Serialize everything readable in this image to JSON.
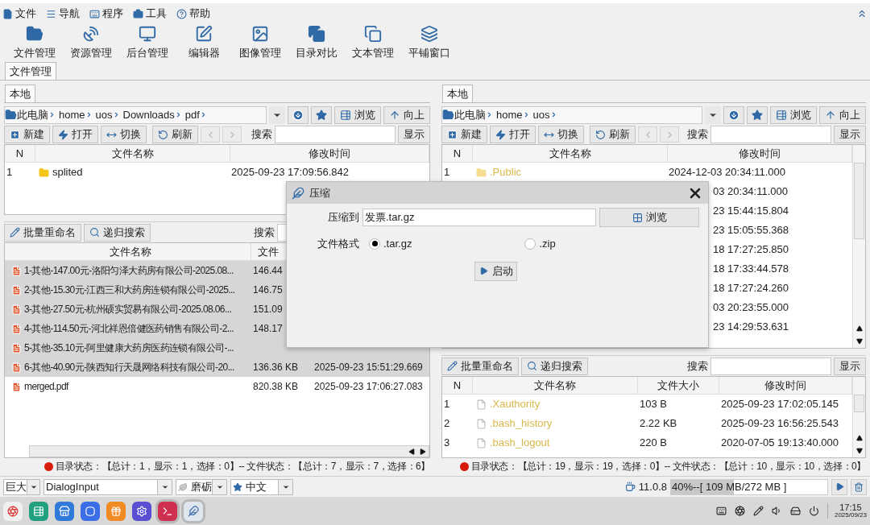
{
  "menu": [
    {
      "label": "文件"
    },
    {
      "label": "导航"
    },
    {
      "label": "程序"
    },
    {
      "label": "工具"
    },
    {
      "label": "帮助"
    }
  ],
  "toolbar": [
    {
      "label": "文件管理"
    },
    {
      "label": "资源管理"
    },
    {
      "label": "后台管理"
    },
    {
      "label": "编辑器"
    },
    {
      "label": "图像管理"
    },
    {
      "label": "目录对比"
    },
    {
      "label": "文本管理"
    },
    {
      "label": "平铺窗口"
    }
  ],
  "main_tabs": [
    {
      "label": "文件管理",
      "selected": true
    }
  ],
  "panes": [
    {
      "tab": {
        "label": "本地",
        "selected": true
      },
      "path": [
        "此电脑",
        "home",
        "uos",
        "Downloads",
        "pdf"
      ],
      "browse": "浏览",
      "up": "向上",
      "actions": [
        "新建",
        "打开",
        "切换",
        "刷新"
      ],
      "nav": [
        {
          "disabled": true
        },
        {
          "disabled": true
        }
      ],
      "search_label": "搜索",
      "show": "显示",
      "top_table": {
        "columns": [
          "N",
          "文件名称",
          "修改时间"
        ],
        "rows": [
          {
            "kind": "full",
            "n": "1",
            "name": "splited",
            "hidden": false,
            "time": "2025-09-23 17:09:56.842"
          }
        ]
      },
      "bottom_tools": [
        "批量重命名",
        "递归搜索"
      ],
      "bottom_search_label": "搜索",
      "bottom_table": {
        "columns": [
          "文件名称",
          "文件"
        ],
        "rows": [
          {
            "name": "1-其他-147.00元-洛阳匀泽大药房有限公司-2025.08...",
            "size": "146.44",
            "selected": true
          },
          {
            "name": "2-其他-15.30元-江西三和大药房连锁有限公司-2025...",
            "size": "146.75",
            "selected": true
          },
          {
            "name": "3-其他-27.50元-杭州硕实贸易有限公司-2025.08.06...",
            "size": "151.09",
            "selected": true
          },
          {
            "name": "4-其他-114.50元-河北祥恩倍健医药销售有限公司-2...",
            "size": "148.17",
            "selected": true
          },
          {
            "name": "5-其他-35.10元-阿里健康大药房医药连锁有限公司-...",
            "selected": true
          },
          {
            "name": "6-其他-40.90元-陕西知行天晟网络科技有限公司-20...",
            "size": "136.36 KB",
            "time": "2025-09-23 15:51:29.669",
            "selected": true
          },
          {
            "name": "merged.pdf",
            "size": "820.38 KB",
            "time": "2025-09-23 17:06:27.083",
            "selected": false
          }
        ]
      },
      "status": "目录状态：【总计：1，显示：1，选择：0】-- 文件状态：【总计：7，显示：7，选择：6】"
    },
    {
      "tab": {
        "label": "本地",
        "selected": true
      },
      "path": [
        "此电脑",
        "home",
        "uos"
      ],
      "browse": "浏览",
      "up": "向上",
      "actions": [
        "新建",
        "打开",
        "切换",
        "刷新"
      ],
      "nav": [
        {
          "disabled": true
        },
        {
          "disabled": true
        }
      ],
      "search_label": "搜索",
      "show": "显示",
      "top_table": {
        "columns": [
          "N",
          "文件名称",
          "修改时间"
        ],
        "rows": [
          {
            "kind": "full",
            "n": "1",
            "name": ".Public",
            "hidden": true,
            "time": "2024-12-03 20:34:11.000"
          },
          {
            "kind": "partial",
            "time": "03 20:34:11.000"
          },
          {
            "kind": "partial",
            "time": "23 15:44:15.804"
          },
          {
            "kind": "partial",
            "time": "23 15:05:55.368"
          },
          {
            "kind": "partial",
            "time": "18 17:27:25.850"
          },
          {
            "kind": "partial",
            "time": "18 17:33:44.578"
          },
          {
            "kind": "partial",
            "time": "18 17:27:24.260"
          },
          {
            "kind": "partial",
            "time": "03 20:23:55.000"
          },
          {
            "kind": "partial",
            "time": "23 14:29:53.631"
          }
        ]
      },
      "bottom_tools": [
        "批量重命名",
        "递归搜索"
      ],
      "bottom_search_label": "搜索",
      "bottom_show": "显示",
      "bottom_table": {
        "columns": [
          "N",
          "文件名称",
          "文件大小",
          "修改时间"
        ],
        "rows": [
          {
            "n": "1",
            "name": ".Xauthority",
            "size": "103 B",
            "time": "2025-09-23 17:02:05.145",
            "hidden": true
          },
          {
            "n": "2",
            "name": ".bash_history",
            "size": "2.22 KB",
            "time": "2025-09-23 16:56:25.543",
            "hidden": true
          },
          {
            "n": "3",
            "name": ".bash_logout",
            "size": "220 B",
            "time": "2020-07-05 19:13:40.000",
            "hidden": true
          }
        ]
      },
      "status": "目录状态：【总计：19，显示：19，选择：0】-- 文件状态：【总计：10，显示：10，选择：0】"
    }
  ],
  "dialog": {
    "title": "压缩",
    "target_label": "压缩到",
    "target_value": "发票.tar.gz",
    "browse": "浏览",
    "format_label": "文件格式",
    "formats": [
      {
        "label": ".tar.gz",
        "selected": true
      },
      {
        "label": ".zip",
        "selected": false
      }
    ],
    "start": "启动"
  },
  "bottom_bar": {
    "selects": [
      "巨大",
      "DialogInput",
      "磨砺",
      "中文"
    ],
    "version": "11.0.8",
    "memory": {
      "text": "40%--[ 109 MB/272 MB ]",
      "level": 0.4
    }
  },
  "taskbar": {
    "time": "17:15",
    "date": "2025/09/23"
  }
}
